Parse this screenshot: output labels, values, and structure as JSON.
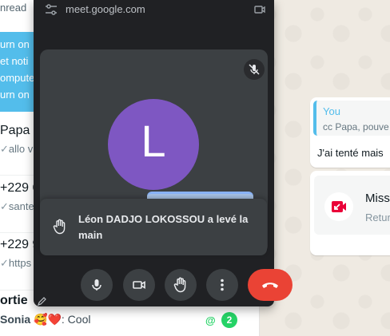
{
  "meet": {
    "url": "meet.google.com",
    "participant_initial": "L",
    "notification": "Léon DADJO LOKOSSOU a levé la main",
    "colors": {
      "window_bg": "#202124",
      "tile_bg": "#3c4043",
      "avatar": "#7e57c2",
      "end_call": "#ea4335"
    },
    "controls": [
      "mic-icon",
      "camera-icon",
      "raise-hand-icon",
      "more-options-icon",
      "end-call-icon"
    ]
  },
  "chatlist": {
    "unread_label": "nread",
    "banner_lines": [
      "urn on",
      "et noti",
      "omputer",
      "urn on"
    ],
    "rows": [
      {
        "title": "Papa C",
        "subtitle": "allo v"
      },
      {
        "title": "+229 6",
        "subtitle": "sante"
      },
      {
        "title": "+229 9",
        "subtitle": "https"
      }
    ],
    "last_row": {
      "title": "ortie",
      "preview_sender": "Sonia",
      "preview_text": ": Cool",
      "mention": "@",
      "unread_count": "2"
    }
  },
  "chat": {
    "quoted_author": "You",
    "quoted_text": "cc Papa, pouve",
    "message_text": "J'ai tenté mais",
    "missed_call_title": "Miss",
    "missed_call_sub": "Retur"
  }
}
